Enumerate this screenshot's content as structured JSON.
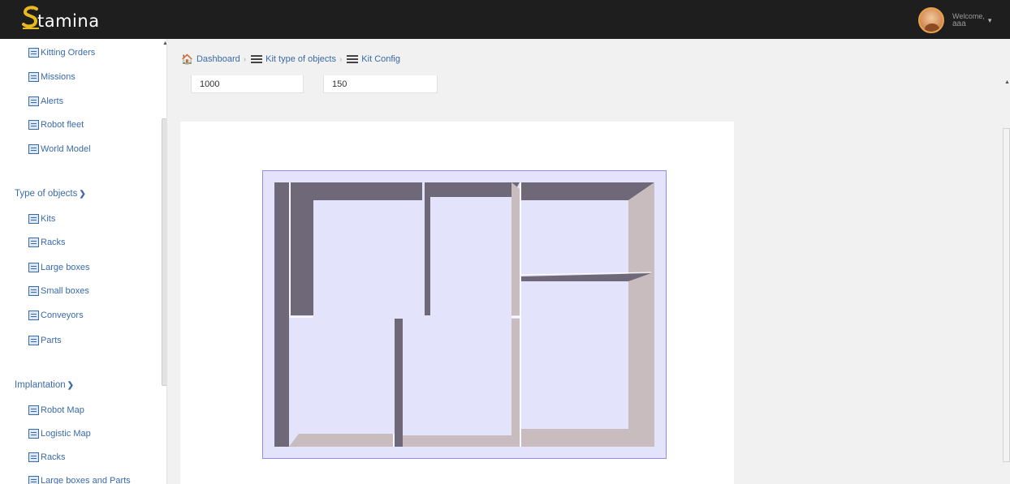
{
  "app": {
    "logo_text": "tamina"
  },
  "user": {
    "welcome": "Welcome,",
    "name": "aaa"
  },
  "sidebar": {
    "top_items": [
      {
        "label": "Kitting Orders"
      },
      {
        "label": "Missions"
      },
      {
        "label": "Alerts"
      },
      {
        "label": "Robot fleet"
      },
      {
        "label": "World Model"
      }
    ],
    "type_section": {
      "title": "Type of objects"
    },
    "type_items": [
      {
        "label": "Kits"
      },
      {
        "label": "Racks"
      },
      {
        "label": "Large boxes"
      },
      {
        "label": "Small boxes"
      },
      {
        "label": "Conveyors"
      },
      {
        "label": "Parts"
      }
    ],
    "impl_section": {
      "title": "Implantation"
    },
    "impl_items": [
      {
        "label": "Robot Map"
      },
      {
        "label": "Logistic Map"
      },
      {
        "label": "Racks"
      },
      {
        "label": "Large boxes and Parts"
      }
    ]
  },
  "breadcrumb": {
    "items": [
      {
        "label": "Dashboard"
      },
      {
        "label": "Kit type of objects"
      },
      {
        "label": "Kit Config"
      }
    ]
  },
  "form": {
    "field1_value": "1000",
    "field2_value": "150"
  },
  "colors": {
    "topbar": "#1e1e1e",
    "link": "#3a6aa8",
    "scene_floor": "#e3e3fb",
    "wall_dark": "#6f6878",
    "wall_light": "#c9bcbe"
  }
}
